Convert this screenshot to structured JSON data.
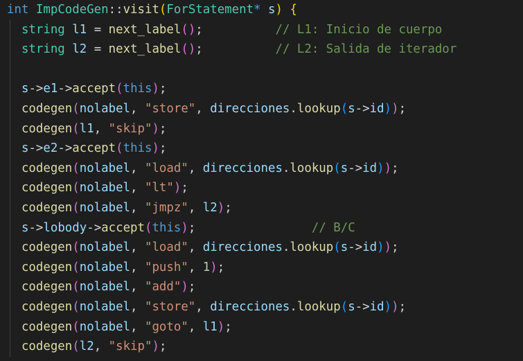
{
  "colors": {
    "background": "#1e1e1e",
    "keyword": "#569cd6",
    "type": "#4ec9b0",
    "function": "#dcdcaa",
    "variable": "#9cdcfe",
    "string": "#ce9178",
    "number": "#b5cea8",
    "comment": "#6a9955",
    "plain": "#d4d4d4",
    "bracket1": "#ffd700",
    "bracket2": "#da70d6",
    "bracket3": "#179fff"
  },
  "code_lines": [
    [
      [
        "int",
        "keyword"
      ],
      [
        " ",
        "plain"
      ],
      [
        "ImpCodeGen",
        "type"
      ],
      [
        "::",
        "plain"
      ],
      [
        "visit",
        "function"
      ],
      [
        "(",
        "bracket1"
      ],
      [
        "ForStatement",
        "type"
      ],
      [
        "* ",
        "keyword"
      ],
      [
        "s",
        "variable"
      ],
      [
        ")",
        "bracket1"
      ],
      [
        " ",
        "plain"
      ],
      [
        "{",
        "bracket1"
      ]
    ],
    [
      [
        "  ",
        "plain"
      ],
      [
        "string",
        "type"
      ],
      [
        " ",
        "plain"
      ],
      [
        "l1",
        "variable"
      ],
      [
        " = ",
        "plain"
      ],
      [
        "next_label",
        "function"
      ],
      [
        "()",
        "bracket2"
      ],
      [
        ";",
        "plain"
      ],
      [
        "          ",
        "plain"
      ],
      [
        "// L1: Inicio de cuerpo",
        "comment"
      ]
    ],
    [
      [
        "  ",
        "plain"
      ],
      [
        "string",
        "type"
      ],
      [
        " ",
        "plain"
      ],
      [
        "l2",
        "variable"
      ],
      [
        " = ",
        "plain"
      ],
      [
        "next_label",
        "function"
      ],
      [
        "()",
        "bracket2"
      ],
      [
        ";",
        "plain"
      ],
      [
        "          ",
        "plain"
      ],
      [
        "// L2: Salida de iterador",
        "comment"
      ]
    ],
    [],
    [
      [
        "  ",
        "plain"
      ],
      [
        "s",
        "variable"
      ],
      [
        "->",
        "plain"
      ],
      [
        "e1",
        "variable"
      ],
      [
        "->",
        "plain"
      ],
      [
        "accept",
        "function"
      ],
      [
        "(",
        "bracket2"
      ],
      [
        "this",
        "keyword"
      ],
      [
        ")",
        "bracket2"
      ],
      [
        ";",
        "plain"
      ]
    ],
    [
      [
        "  ",
        "plain"
      ],
      [
        "codegen",
        "function"
      ],
      [
        "(",
        "bracket2"
      ],
      [
        "nolabel",
        "variable"
      ],
      [
        ", ",
        "plain"
      ],
      [
        "\"store\"",
        "string"
      ],
      [
        ", ",
        "plain"
      ],
      [
        "direcciones",
        "variable"
      ],
      [
        ".",
        "plain"
      ],
      [
        "lookup",
        "function"
      ],
      [
        "(",
        "bracket3"
      ],
      [
        "s",
        "variable"
      ],
      [
        "->",
        "plain"
      ],
      [
        "id",
        "variable"
      ],
      [
        ")",
        "bracket3"
      ],
      [
        ")",
        "bracket2"
      ],
      [
        ";",
        "plain"
      ]
    ],
    [
      [
        "  ",
        "plain"
      ],
      [
        "codegen",
        "function"
      ],
      [
        "(",
        "bracket2"
      ],
      [
        "l1",
        "variable"
      ],
      [
        ", ",
        "plain"
      ],
      [
        "\"skip\"",
        "string"
      ],
      [
        ")",
        "bracket2"
      ],
      [
        ";",
        "plain"
      ]
    ],
    [
      [
        "  ",
        "plain"
      ],
      [
        "s",
        "variable"
      ],
      [
        "->",
        "plain"
      ],
      [
        "e2",
        "variable"
      ],
      [
        "->",
        "plain"
      ],
      [
        "accept",
        "function"
      ],
      [
        "(",
        "bracket2"
      ],
      [
        "this",
        "keyword"
      ],
      [
        ")",
        "bracket2"
      ],
      [
        ";",
        "plain"
      ]
    ],
    [
      [
        "  ",
        "plain"
      ],
      [
        "codegen",
        "function"
      ],
      [
        "(",
        "bracket2"
      ],
      [
        "nolabel",
        "variable"
      ],
      [
        ", ",
        "plain"
      ],
      [
        "\"load\"",
        "string"
      ],
      [
        ", ",
        "plain"
      ],
      [
        "direcciones",
        "variable"
      ],
      [
        ".",
        "plain"
      ],
      [
        "lookup",
        "function"
      ],
      [
        "(",
        "bracket3"
      ],
      [
        "s",
        "variable"
      ],
      [
        "->",
        "plain"
      ],
      [
        "id",
        "variable"
      ],
      [
        ")",
        "bracket3"
      ],
      [
        ")",
        "bracket2"
      ],
      [
        ";",
        "plain"
      ]
    ],
    [
      [
        "  ",
        "plain"
      ],
      [
        "codegen",
        "function"
      ],
      [
        "(",
        "bracket2"
      ],
      [
        "nolabel",
        "variable"
      ],
      [
        ", ",
        "plain"
      ],
      [
        "\"lt\"",
        "string"
      ],
      [
        ")",
        "bracket2"
      ],
      [
        ";",
        "plain"
      ]
    ],
    [
      [
        "  ",
        "plain"
      ],
      [
        "codegen",
        "function"
      ],
      [
        "(",
        "bracket2"
      ],
      [
        "nolabel",
        "variable"
      ],
      [
        ", ",
        "plain"
      ],
      [
        "\"jmpz\"",
        "string"
      ],
      [
        ", ",
        "plain"
      ],
      [
        "l2",
        "variable"
      ],
      [
        ")",
        "bracket2"
      ],
      [
        ";",
        "plain"
      ]
    ],
    [
      [
        "  ",
        "plain"
      ],
      [
        "s",
        "variable"
      ],
      [
        "->",
        "plain"
      ],
      [
        "lobody",
        "variable"
      ],
      [
        "->",
        "plain"
      ],
      [
        "accept",
        "function"
      ],
      [
        "(",
        "bracket2"
      ],
      [
        "this",
        "keyword"
      ],
      [
        ")",
        "bracket2"
      ],
      [
        ";",
        "plain"
      ],
      [
        "                ",
        "plain"
      ],
      [
        "// B/C",
        "comment"
      ]
    ],
    [
      [
        "  ",
        "plain"
      ],
      [
        "codegen",
        "function"
      ],
      [
        "(",
        "bracket2"
      ],
      [
        "nolabel",
        "variable"
      ],
      [
        ", ",
        "plain"
      ],
      [
        "\"load\"",
        "string"
      ],
      [
        ", ",
        "plain"
      ],
      [
        "direcciones",
        "variable"
      ],
      [
        ".",
        "plain"
      ],
      [
        "lookup",
        "function"
      ],
      [
        "(",
        "bracket3"
      ],
      [
        "s",
        "variable"
      ],
      [
        "->",
        "plain"
      ],
      [
        "id",
        "variable"
      ],
      [
        ")",
        "bracket3"
      ],
      [
        ")",
        "bracket2"
      ],
      [
        ";",
        "plain"
      ]
    ],
    [
      [
        "  ",
        "plain"
      ],
      [
        "codegen",
        "function"
      ],
      [
        "(",
        "bracket2"
      ],
      [
        "nolabel",
        "variable"
      ],
      [
        ", ",
        "plain"
      ],
      [
        "\"push\"",
        "string"
      ],
      [
        ", ",
        "plain"
      ],
      [
        "1",
        "number"
      ],
      [
        ")",
        "bracket2"
      ],
      [
        ";",
        "plain"
      ]
    ],
    [
      [
        "  ",
        "plain"
      ],
      [
        "codegen",
        "function"
      ],
      [
        "(",
        "bracket2"
      ],
      [
        "nolabel",
        "variable"
      ],
      [
        ", ",
        "plain"
      ],
      [
        "\"add\"",
        "string"
      ],
      [
        ")",
        "bracket2"
      ],
      [
        ";",
        "plain"
      ]
    ],
    [
      [
        "  ",
        "plain"
      ],
      [
        "codegen",
        "function"
      ],
      [
        "(",
        "bracket2"
      ],
      [
        "nolabel",
        "variable"
      ],
      [
        ", ",
        "plain"
      ],
      [
        "\"store\"",
        "string"
      ],
      [
        ", ",
        "plain"
      ],
      [
        "direcciones",
        "variable"
      ],
      [
        ".",
        "plain"
      ],
      [
        "lookup",
        "function"
      ],
      [
        "(",
        "bracket3"
      ],
      [
        "s",
        "variable"
      ],
      [
        "->",
        "plain"
      ],
      [
        "id",
        "variable"
      ],
      [
        ")",
        "bracket3"
      ],
      [
        ")",
        "bracket2"
      ],
      [
        ";",
        "plain"
      ]
    ],
    [
      [
        "  ",
        "plain"
      ],
      [
        "codegen",
        "function"
      ],
      [
        "(",
        "bracket2"
      ],
      [
        "nolabel",
        "variable"
      ],
      [
        ", ",
        "plain"
      ],
      [
        "\"goto\"",
        "string"
      ],
      [
        ", ",
        "plain"
      ],
      [
        "l1",
        "variable"
      ],
      [
        ")",
        "bracket2"
      ],
      [
        ";",
        "plain"
      ]
    ],
    [
      [
        "  ",
        "plain"
      ],
      [
        "codegen",
        "function"
      ],
      [
        "(",
        "bracket2"
      ],
      [
        "l2",
        "variable"
      ],
      [
        ", ",
        "plain"
      ],
      [
        "\"skip\"",
        "string"
      ],
      [
        ")",
        "bracket2"
      ],
      [
        ";",
        "plain"
      ]
    ]
  ]
}
